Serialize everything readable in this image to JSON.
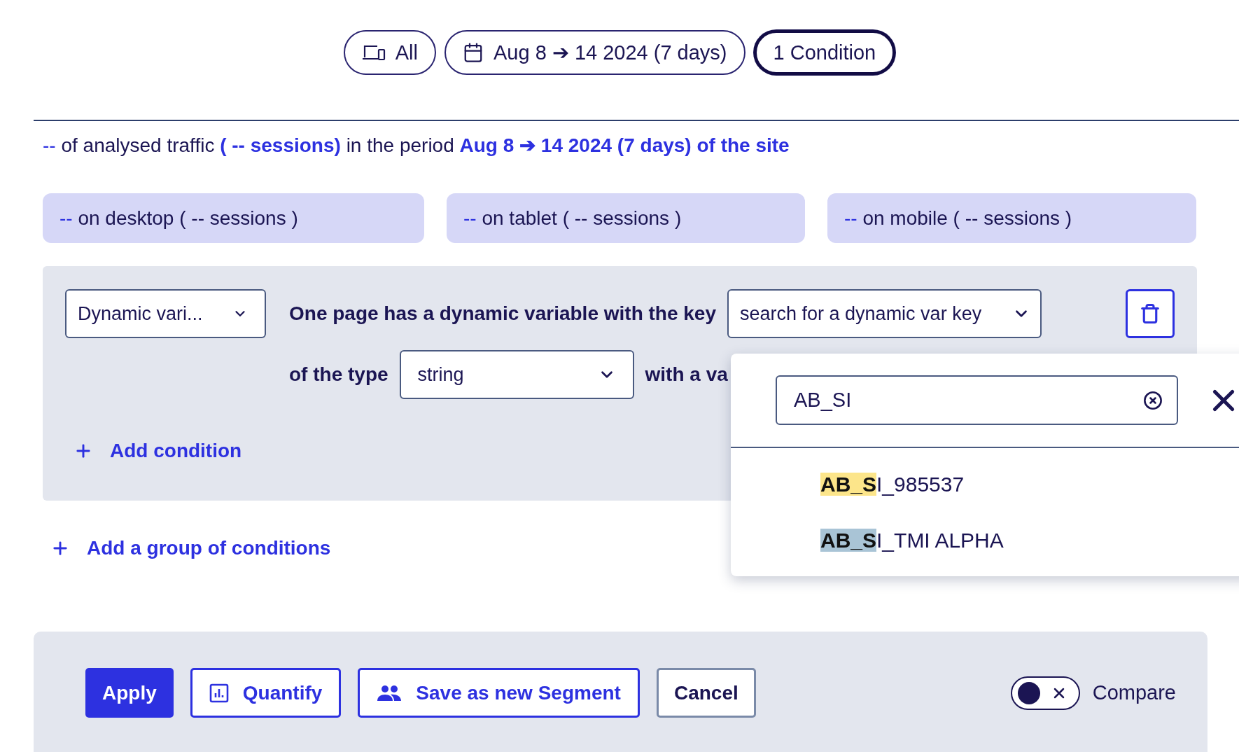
{
  "filters": [
    {
      "kind": "devices",
      "label": "All",
      "selected": false
    },
    {
      "kind": "date",
      "label": "Aug 8 ➔ 14 2024 (7 days)",
      "selected": false
    },
    {
      "kind": "condition",
      "label": "1 Condition",
      "selected": true
    }
  ],
  "summary": [
    {
      "text": "--",
      "kind": "accent"
    },
    {
      "text": " of analysed traffic ",
      "kind": "plain"
    },
    {
      "text": "( -- sessions)",
      "kind": "strong"
    },
    {
      "text": " in the period ",
      "kind": "plain"
    },
    {
      "text": "Aug 8 ➔ 14 2024 (7 days) of the site",
      "kind": "strong"
    }
  ],
  "devices": [
    {
      "value": "--",
      "label": " on desktop ( -- sessions )"
    },
    {
      "value": "--",
      "label": " on tablet ( -- sessions )"
    },
    {
      "value": "--",
      "label": " on mobile ( -- sessions )"
    }
  ],
  "condition": {
    "category": "Dynamic vari...",
    "sentence": "One page has a dynamic variable with the key",
    "key_placeholder": "search for a dynamic var key",
    "type_label": "of the type",
    "type_value": "string",
    "value_label": "with a va"
  },
  "add_condition": "Add condition",
  "add_group": "Add a group of conditions",
  "key_popup": {
    "query": "AB_SI",
    "results": [
      {
        "match": "AB_S",
        "rest": "I_985537",
        "selected": false
      },
      {
        "match": "AB_S",
        "rest": "I_TMI ALPHA",
        "selected": true
      }
    ]
  },
  "actions": [
    {
      "kind": "primary",
      "label": "Apply"
    },
    {
      "kind": "quantify",
      "label": "Quantify"
    },
    {
      "kind": "segment",
      "label": "Save as new Segment"
    },
    {
      "kind": "cancel",
      "label": "Cancel"
    }
  ],
  "compare": {
    "label": "Compare",
    "on": false
  }
}
